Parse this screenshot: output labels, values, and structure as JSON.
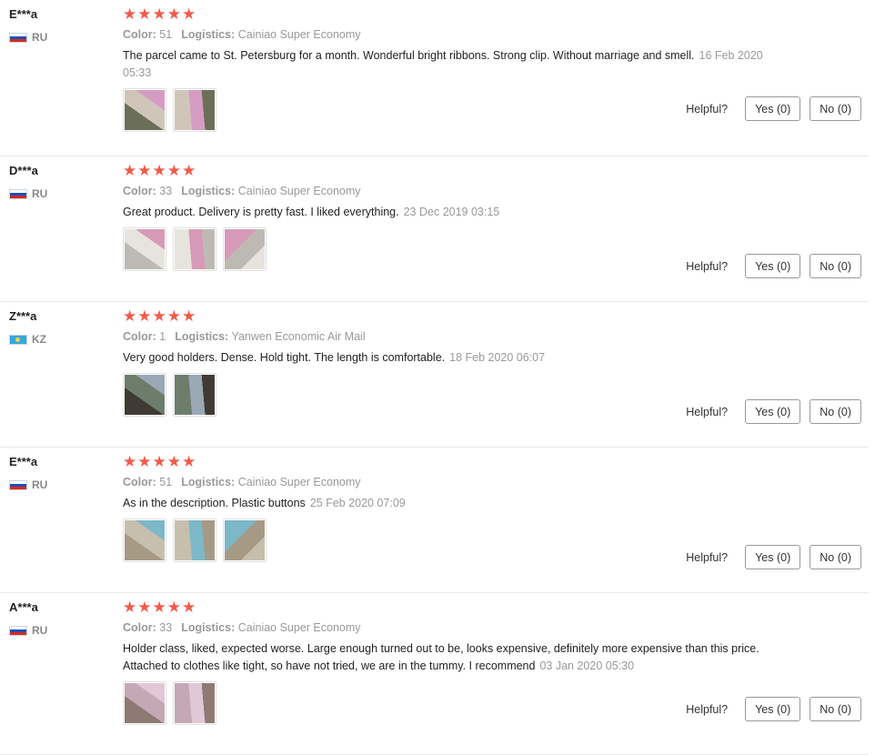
{
  "labels": {
    "color": "Color:",
    "logistics": "Logistics:",
    "helpful": "Helpful?"
  },
  "colors": {
    "star": "#f15a4b",
    "muted": "#999999"
  },
  "reviews": [
    {
      "user": "E***a",
      "country": "RU",
      "flag_icon": "flag-ru-icon",
      "stars": 5,
      "color": "51",
      "logistics": "Cainiao Super Economy",
      "text": "The parcel came to St. Petersburg for a month. Wonderful bright ribbons. Strong clip. Without marriage and smell.",
      "date": "16 Feb 2020 05:33",
      "photos": 2,
      "yes": "Yes (0)",
      "no": "No (0)"
    },
    {
      "user": "D***a",
      "country": "RU",
      "flag_icon": "flag-ru-icon",
      "stars": 5,
      "color": "33",
      "logistics": "Cainiao Super Economy",
      "text": "Great product. Delivery is pretty fast. I liked everything.",
      "date": "23 Dec 2019 03:15",
      "photos": 3,
      "yes": "Yes (0)",
      "no": "No (0)"
    },
    {
      "user": "Z***a",
      "country": "KZ",
      "flag_icon": "flag-kz-icon",
      "stars": 5,
      "color": "1",
      "logistics": "Yanwen Economic Air Mail",
      "text": "Very good holders. Dense. Hold tight. The length is comfortable.",
      "date": "18 Feb 2020 06:07",
      "photos": 2,
      "yes": "Yes (0)",
      "no": "No (0)"
    },
    {
      "user": "E***a",
      "country": "RU",
      "flag_icon": "flag-ru-icon",
      "stars": 5,
      "color": "51",
      "logistics": "Cainiao Super Economy",
      "text": "As in the description. Plastic buttons",
      "date": "25 Feb 2020 07:09",
      "photos": 3,
      "yes": "Yes (0)",
      "no": "No (0)"
    },
    {
      "user": "A***a",
      "country": "RU",
      "flag_icon": "flag-ru-icon",
      "stars": 5,
      "color": "33",
      "logistics": "Cainiao Super Economy",
      "text": "Holder class, liked, expected worse. Large enough turned out to be, looks expensive, definitely more expensive than this price. Attached to clothes like tight, so have not tried, we are in the tummy. I recommend",
      "date": "03 Jan 2020 05:30",
      "photos": 2,
      "yes": "Yes (0)",
      "no": "No (0)"
    }
  ]
}
